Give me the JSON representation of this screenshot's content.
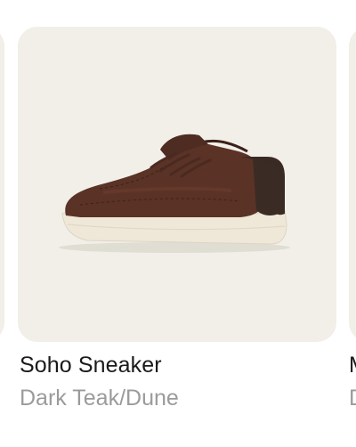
{
  "carousel": {
    "left_card": {
      "image_alt": "previous product"
    },
    "current_card": {
      "name": "Soho Sneaker",
      "color": "Dark Teak/Dune",
      "image_icon": "sneaker-icon",
      "colors": {
        "card_background": "#f1efe8",
        "leather": "#5a3226",
        "heel_tab": "#3a2a24",
        "sole": "#efe8d9"
      }
    },
    "right_card": {
      "name_partial": "M",
      "color_partial": "D"
    }
  }
}
